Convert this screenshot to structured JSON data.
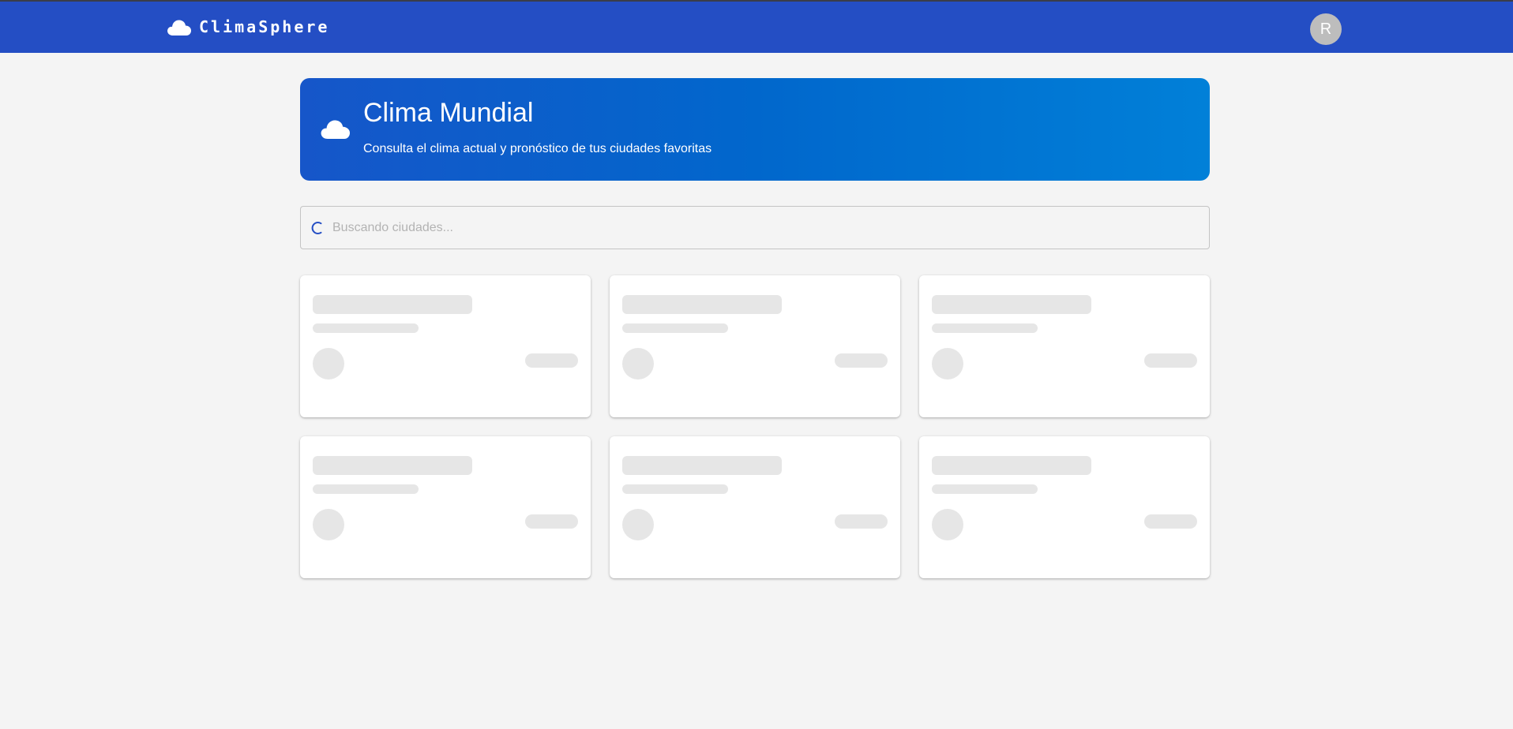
{
  "header": {
    "brand_name": "ClimaSphere",
    "brand_icon": "cloud-icon",
    "avatar_initial": "R",
    "background_color": "#244ec4"
  },
  "hero": {
    "icon": "cloud-icon",
    "title": "Clima Mundial",
    "subtitle": "Consulta el clima actual y pronóstico de tus ciudades favoritas",
    "gradient_start": "#1656c9",
    "gradient_end": "#0180d8"
  },
  "search": {
    "placeholder": "Buscando ciudades...",
    "value": "",
    "loading": true,
    "spinner_color": "#244ec4"
  },
  "city_cards": {
    "state": "loading",
    "skeleton_count": 6,
    "skeleton_color": "#e6e6e6"
  }
}
